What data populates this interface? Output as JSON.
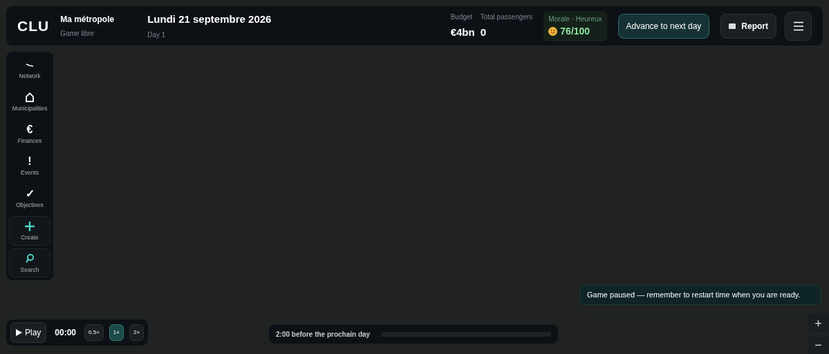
{
  "header": {
    "logo": "CLU",
    "city": "Ma métropole",
    "mode": "Game libre",
    "date": "Lundi 21 septembre 2026",
    "day": "Day 1",
    "stats": [
      {
        "label": "Budget",
        "value": "€4bn"
      },
      {
        "label": "Total passengers",
        "value": "0"
      }
    ],
    "morale": {
      "label": "Morale · Heureux",
      "value": "76/100"
    },
    "buttons": [
      {
        "kind": "advance",
        "label": "Advance to next day"
      },
      {
        "kind": "report",
        "label": "Report"
      },
      {
        "kind": "menu"
      }
    ]
  },
  "sidebar": {
    "items": [
      {
        "kind": "nav",
        "label": "Network"
      },
      {
        "kind": "nav",
        "label": "Municipalities"
      },
      {
        "kind": "nav",
        "symbol": "€",
        "label": "Finances"
      },
      {
        "kind": "nav",
        "symbol": "!",
        "label": "Events"
      },
      {
        "kind": "nav",
        "symbol": "✓",
        "label": "Objectives"
      },
      {
        "kind": "action",
        "label": "Create"
      },
      {
        "kind": "action",
        "label": "Search"
      }
    ]
  },
  "playbar": {
    "play": "Play",
    "time": "00:00",
    "speeds": [
      {
        "label": "0.5×",
        "selected": false
      },
      {
        "label": "1×",
        "selected": true
      },
      {
        "label": "2×",
        "selected": false
      }
    ]
  },
  "day_progress": {
    "text": "2:00 before the prochain day"
  },
  "toast": "Game paused — remember to restart time when you are ready.",
  "zoom": [
    "+",
    "−"
  ]
}
